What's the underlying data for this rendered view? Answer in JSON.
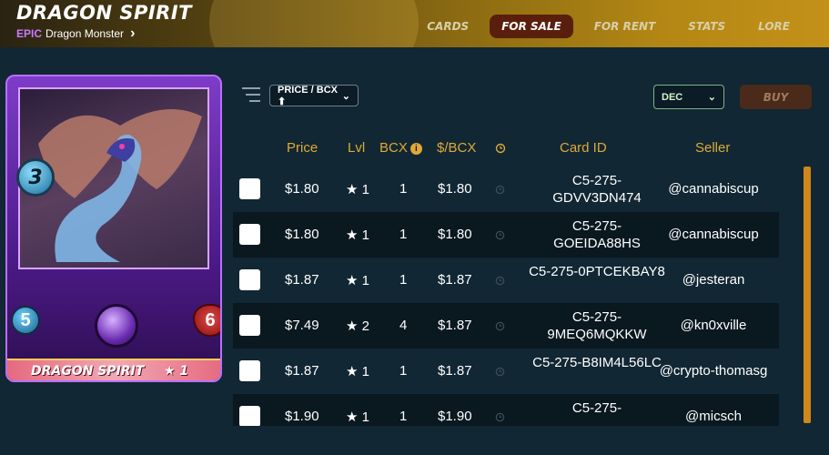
{
  "header": {
    "title": "DRAGON SPIRIT",
    "rarity": "EPIC",
    "subtitle": "Dragon Monster",
    "tabs": [
      {
        "label": "CARDS",
        "active": false
      },
      {
        "label": "FOR SALE",
        "active": true
      },
      {
        "label": "FOR RENT",
        "active": false
      },
      {
        "label": "STATS",
        "active": false
      },
      {
        "label": "LORE",
        "active": false
      }
    ]
  },
  "card": {
    "mana": "3",
    "speed": "5",
    "health": "6",
    "name": "DRAGON SPIRIT",
    "level": "★ 1"
  },
  "controls": {
    "sort_label": "PRICE / BCX ⬆",
    "currency_label": "DEC",
    "buy_label": "BUY"
  },
  "table": {
    "columns": [
      "Price",
      "Lvl",
      "BCX",
      "$/BCX",
      "Card ID",
      "Seller"
    ],
    "rows": [
      {
        "price": "$1.80",
        "lvl": "★ 1",
        "bcx": "1",
        "usd_bcx": "$1.80",
        "card_id": "C5-275-GDVV3DN474",
        "seller": "@cannabiscup"
      },
      {
        "price": "$1.80",
        "lvl": "★ 1",
        "bcx": "1",
        "usd_bcx": "$1.80",
        "card_id": "C5-275-GOEIDA88HS",
        "seller": "@cannabiscup"
      },
      {
        "price": "$1.87",
        "lvl": "★ 1",
        "bcx": "1",
        "usd_bcx": "$1.87",
        "card_id": "C5-275-0PTCEKBAY8",
        "seller": "@jesteran"
      },
      {
        "price": "$7.49",
        "lvl": "★ 2",
        "bcx": "4",
        "usd_bcx": "$1.87",
        "card_id": "C5-275-9MEQ6MQKKW",
        "seller": "@kn0xville"
      },
      {
        "price": "$1.87",
        "lvl": "★ 1",
        "bcx": "1",
        "usd_bcx": "$1.87",
        "card_id": "C5-275-B8IM4L56LC",
        "seller": "@crypto-thomasg"
      },
      {
        "price": "$1.90",
        "lvl": "★ 1",
        "bcx": "1",
        "usd_bcx": "$1.90",
        "card_id": "C5-275-",
        "seller": "@micsch"
      }
    ]
  },
  "colors": {
    "accent": "#e0a838",
    "background": "#112733",
    "active_tab": "#5a1f0c"
  }
}
